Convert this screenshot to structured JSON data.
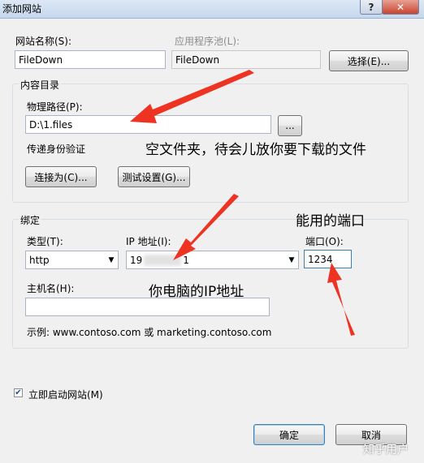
{
  "window": {
    "title": "添加网站",
    "help_glyph": "?",
    "close_glyph": "✕"
  },
  "site": {
    "name_label": "网站名称(S):",
    "name_value": "FileDown",
    "pool_label": "应用程序池(L):",
    "pool_value": "FileDown",
    "select_button": "选择(E)..."
  },
  "content": {
    "group_title": "内容目录",
    "path_label": "物理路径(P):",
    "path_value": "D:\\1.files",
    "browse_button": "...",
    "auth_label": "传递身份验证",
    "connect_as_button": "连接为(C)...",
    "test_settings_button": "测试设置(G)..."
  },
  "binding": {
    "group_title": "绑定",
    "type_label": "类型(T):",
    "type_value": "http",
    "ip_label": "IP 地址(I):",
    "ip_value_prefix": "19",
    "ip_value_suffix": "1",
    "port_label": "端口(O):",
    "port_value": "1234",
    "hostname_label": "主机名(H):",
    "hostname_value": "",
    "example_text": "示例: www.contoso.com 或 marketing.contoso.com"
  },
  "options": {
    "start_immediately_label": "立即启动网站(M)",
    "start_immediately_checked": true
  },
  "footer": {
    "ok_button": "确定",
    "cancel_button": "取消"
  },
  "annotations": {
    "empty_folder_note": "空文件夹，待会儿放你要下载的文件",
    "port_note": "能用的端口",
    "ip_note": "你电脑的IP地址",
    "arrow_color": "#ee3322"
  },
  "watermark": "知乎用户"
}
